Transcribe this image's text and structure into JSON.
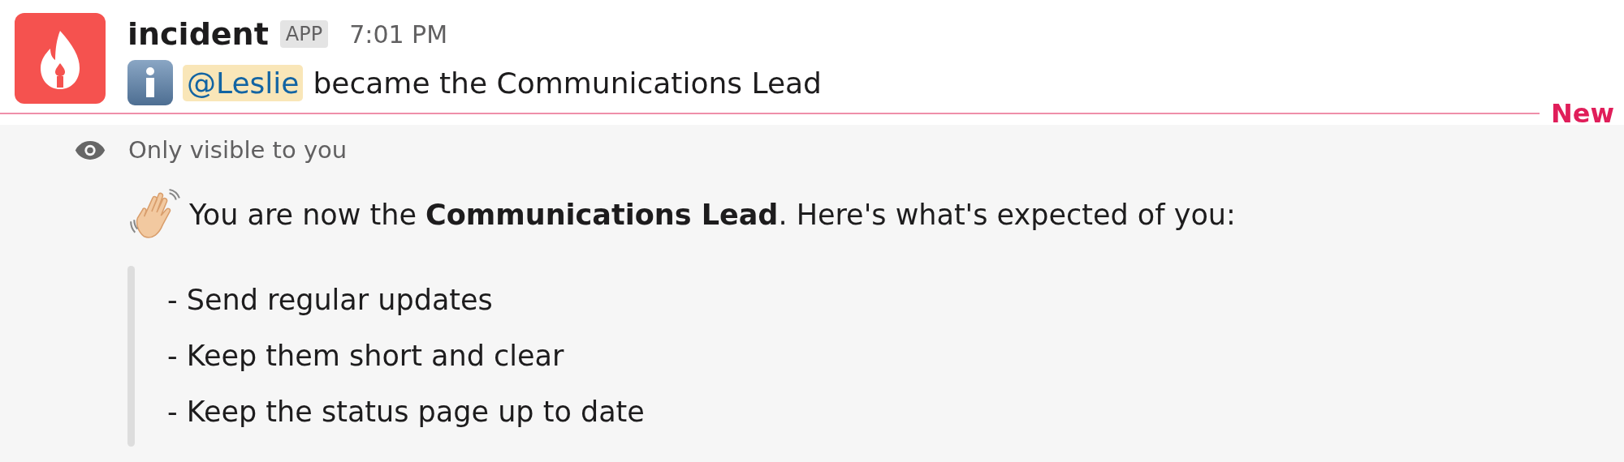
{
  "message": {
    "sender": "incident",
    "badge": "APP",
    "time": "7:01 PM",
    "mention": "@Leslie",
    "text": "became the Communications Lead"
  },
  "new_divider": {
    "label": "New"
  },
  "ephemeral": {
    "note": "Only visible to you",
    "intro": "You are now the **Communications Lead**. Here's what's expected of you:",
    "quote_lines": [
      "- Send regular updates",
      "- Keep them short and clear",
      "- Keep the status page up to date"
    ]
  }
}
